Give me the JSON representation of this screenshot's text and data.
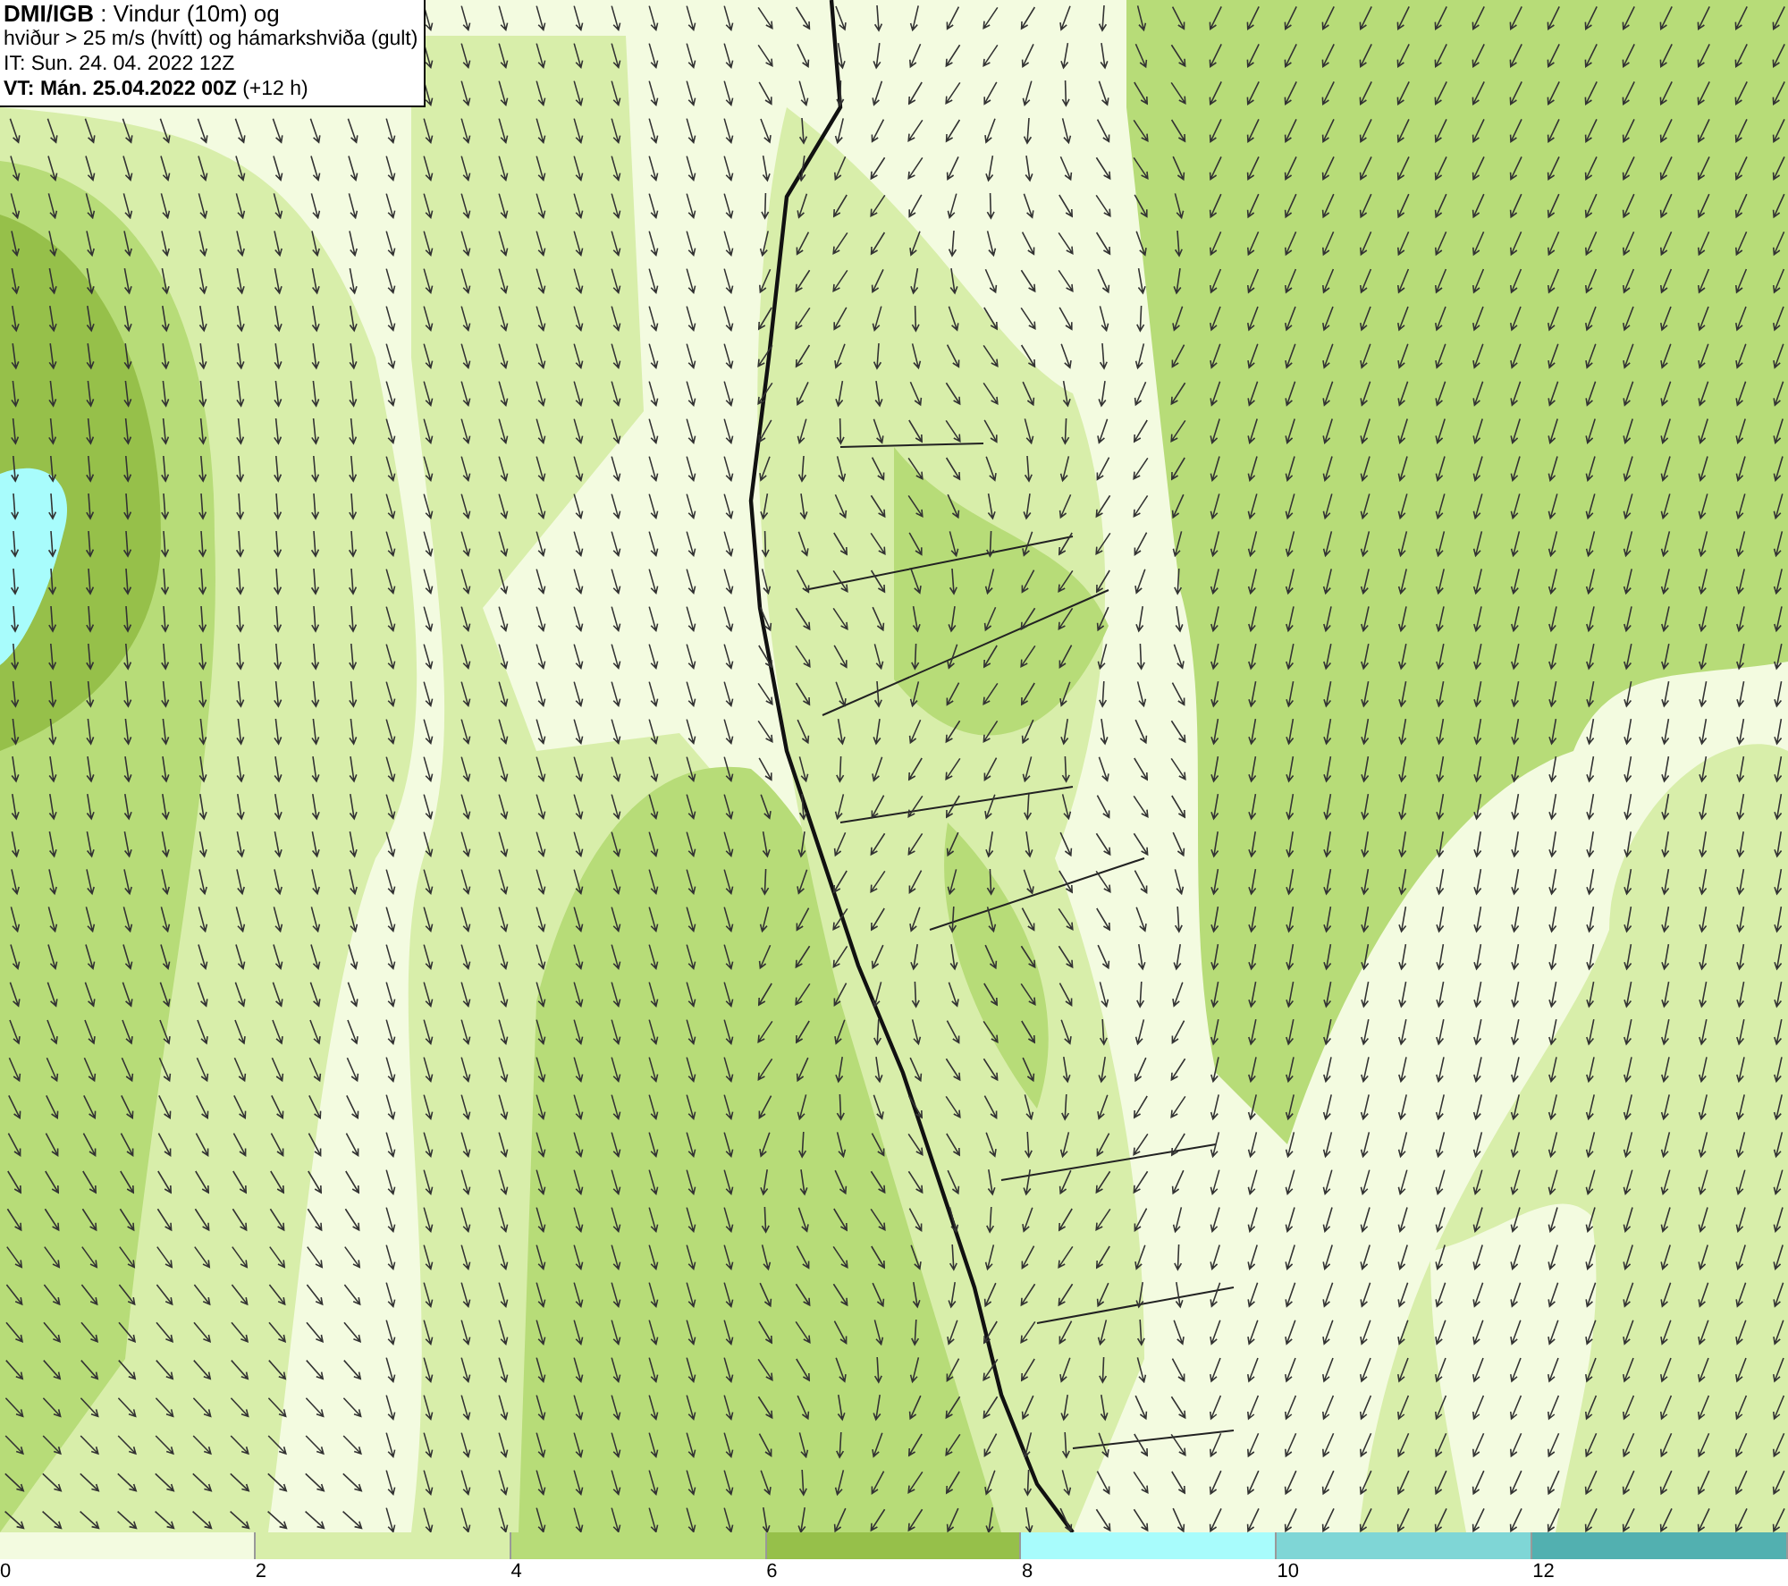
{
  "info_box": {
    "lines": [
      "**DMI/IGB** : Vindur (10m) og",
      "hviður > 25 m/s (hvítt) og hámarkshviða (gult)",
      "IT: Sun. 24. 04. 2022 12Z",
      "**VT: Mán. 25.04.2022 00Z** (+12 h)"
    ]
  },
  "colorbar": {
    "segments": [
      {
        "label": "0",
        "color": "#f3fbe0"
      },
      {
        "label": "2",
        "color": "#d8eeaa"
      },
      {
        "label": "4",
        "color": "#b7dc78"
      },
      {
        "label": "6",
        "color": "#96c04a"
      },
      {
        "label": "8",
        "color": "#a8fcfc"
      },
      {
        "label": "10",
        "color": "#7fd6d6"
      },
      {
        "label": "12",
        "color": "#52b0b0"
      }
    ]
  }
}
